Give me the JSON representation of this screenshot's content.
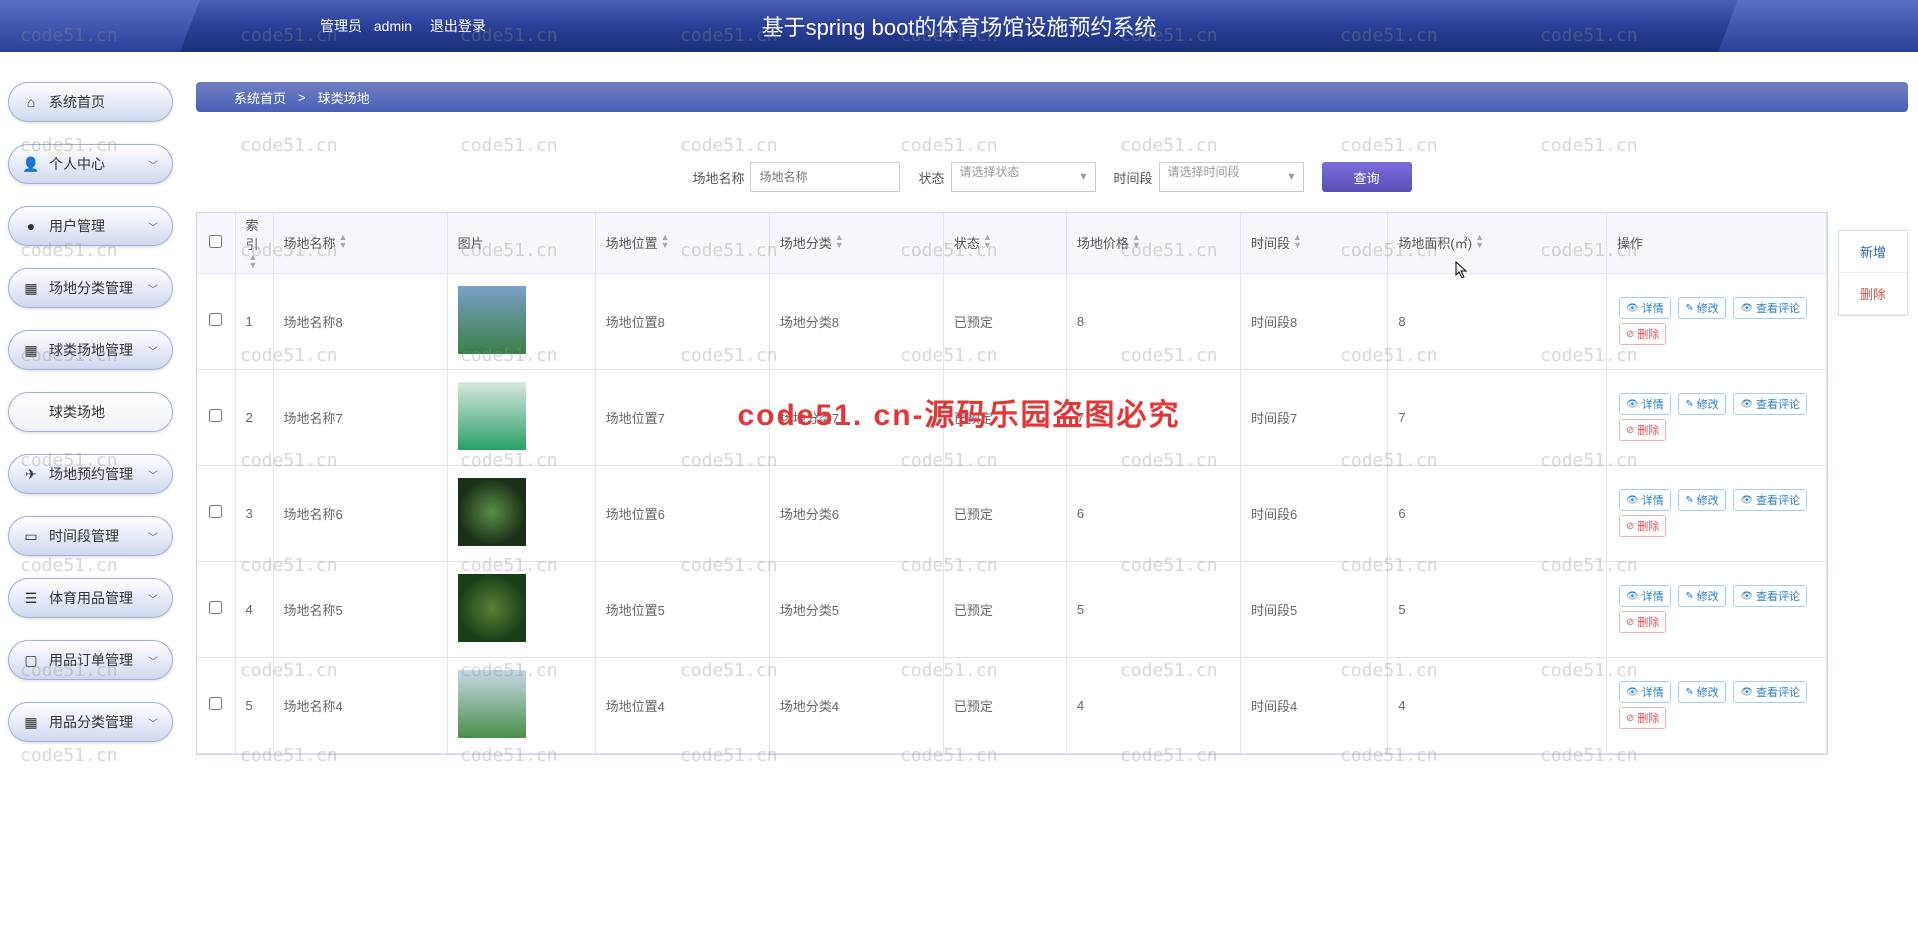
{
  "header": {
    "admin_label": "管理员",
    "admin_name": "admin",
    "logout": "退出登录",
    "title": "基于spring boot的体育场馆设施预约系统"
  },
  "sidebar": {
    "items": [
      {
        "icon": "home",
        "label": "系统首页",
        "expandable": false
      },
      {
        "icon": "user",
        "label": "个人中心",
        "expandable": true
      },
      {
        "icon": "bulb",
        "label": "用户管理",
        "expandable": true
      },
      {
        "icon": "grid",
        "label": "场地分类管理",
        "expandable": true
      },
      {
        "icon": "grid",
        "label": "球类场地管理",
        "expandable": true
      },
      {
        "icon": "",
        "label": "球类场地",
        "expandable": false,
        "active": true
      },
      {
        "icon": "send",
        "label": "场地预约管理",
        "expandable": true
      },
      {
        "icon": "case",
        "label": "时间段管理",
        "expandable": true
      },
      {
        "icon": "list",
        "label": "体育用品管理",
        "expandable": true
      },
      {
        "icon": "monitor",
        "label": "用品订单管理",
        "expandable": true
      },
      {
        "icon": "grid",
        "label": "用品分类管理",
        "expandable": true
      }
    ]
  },
  "breadcrumb": {
    "home": "系统首页",
    "sep": ">",
    "current": "球类场地"
  },
  "filter": {
    "name_label": "场地名称",
    "name_placeholder": "场地名称",
    "status_label": "状态",
    "status_placeholder": "请选择状态",
    "time_label": "时间段",
    "time_placeholder": "请选择时间段",
    "query_btn": "查询"
  },
  "actions": {
    "add": "新增",
    "delete": "删除"
  },
  "table": {
    "headers": {
      "index": "索引",
      "name": "场地名称",
      "image": "图片",
      "location": "场地位置",
      "category": "场地分类",
      "status": "状态",
      "price": "场地价格",
      "time": "时间段",
      "area": "场地面积(㎡)",
      "ops": "操作"
    },
    "ops_labels": {
      "detail": "详情",
      "edit": "修改",
      "comment": "查看评论",
      "delete": "删除"
    },
    "rows": [
      {
        "idx": "1",
        "name": "场地名称8",
        "thumb": "field1",
        "location": "场地位置8",
        "category": "场地分类8",
        "status": "已预定",
        "price": "8",
        "time": "时间段8",
        "area": "8"
      },
      {
        "idx": "2",
        "name": "场地名称7",
        "thumb": "field2",
        "location": "场地位置7",
        "category": "场地分类7",
        "status": "已预定",
        "price": "7",
        "time": "时间段7",
        "area": "7"
      },
      {
        "idx": "3",
        "name": "场地名称6",
        "thumb": "field3",
        "location": "场地位置6",
        "category": "场地分类6",
        "status": "已预定",
        "price": "6",
        "time": "时间段6",
        "area": "6"
      },
      {
        "idx": "4",
        "name": "场地名称5",
        "thumb": "field4",
        "location": "场地位置5",
        "category": "场地分类5",
        "status": "已预定",
        "price": "5",
        "time": "时间段5",
        "area": "5"
      },
      {
        "idx": "5",
        "name": "场地名称4",
        "thumb": "field5",
        "location": "场地位置4",
        "category": "场地分类4",
        "status": "已预定",
        "price": "4",
        "time": "时间段4",
        "area": "4"
      }
    ]
  },
  "watermark": {
    "small": "code51.cn",
    "center": "code51. cn-源码乐园盗图必究"
  }
}
